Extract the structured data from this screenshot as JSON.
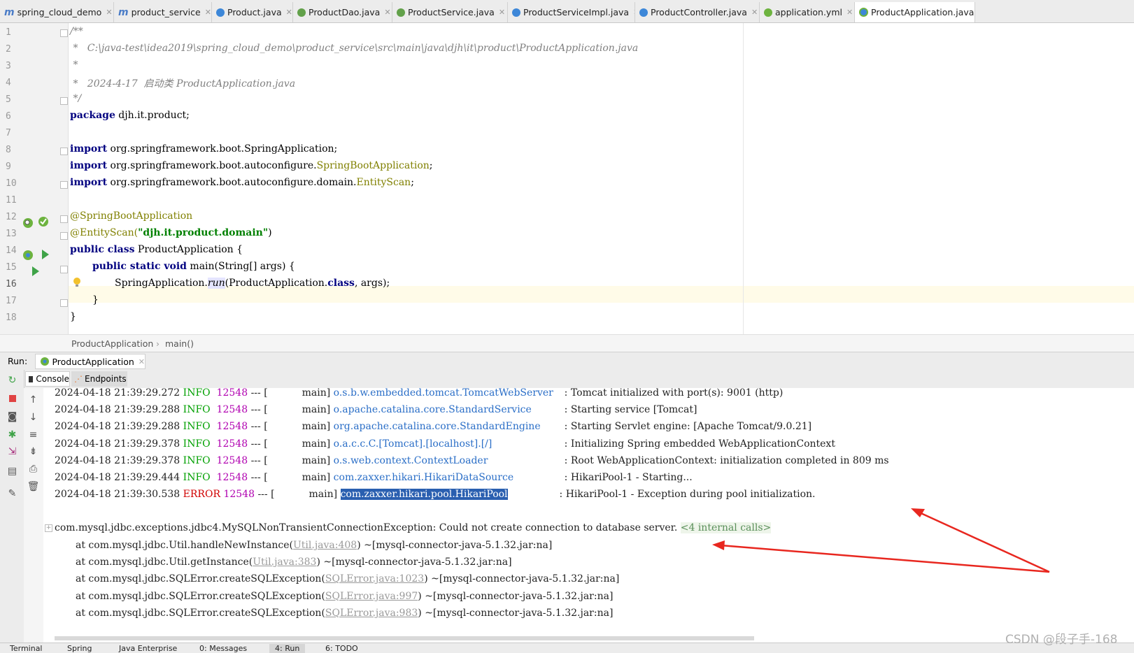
{
  "tabs": [
    {
      "label": "spring_cloud_demo",
      "icon": "maven-icon",
      "active": false
    },
    {
      "label": "product_service",
      "icon": "maven-icon",
      "active": false
    },
    {
      "label": "Product.java",
      "icon": "class-icon",
      "active": false
    },
    {
      "label": "ProductDao.java",
      "icon": "interface-icon",
      "active": false
    },
    {
      "label": "ProductService.java",
      "icon": "interface-icon",
      "active": false
    },
    {
      "label": "ProductServiceImpl.java",
      "icon": "class-icon",
      "active": false
    },
    {
      "label": "ProductController.java",
      "icon": "class-icon",
      "active": false
    },
    {
      "label": "application.yml",
      "icon": "spring-yml-icon",
      "active": false
    },
    {
      "label": "ProductApplication.java",
      "icon": "spring-class-icon",
      "active": true
    }
  ],
  "editor": {
    "line_numbers": [
      "1",
      "2",
      "3",
      "4",
      "5",
      "6",
      "7",
      "8",
      "9",
      "10",
      "11",
      "12",
      "13",
      "14",
      "15",
      "16",
      "17",
      "18"
    ],
    "comment_open": "/**",
    "comment_path": " *   C:\\java-test\\idea2019\\spring_cloud_demo\\product_service\\src\\main\\java\\djh\\it\\product\\ProductApplication.java",
    "comment_star": " *",
    "comment_date": " *   2024-4-17  启动类 ProductApplication.java",
    "comment_close": " */",
    "kw_package": "package",
    "package_name": " djh.it.product;",
    "kw_import": "import",
    "import1": " org.springframework.boot.SpringApplication;",
    "import2_pre": " org.springframework.boot.autoconfigure.",
    "import2_ann": "SpringBootApplication",
    "import3_pre": " org.springframework.boot.autoconfigure.domain.",
    "import3_ann": "EntityScan",
    "semicolon": ";",
    "ann1": "@SpringBootApplication",
    "ann2": "@EntityScan(",
    "ann2_str": "\"djh.it.product.domain\"",
    "ann2_close": ")",
    "kw_public_class": "public class",
    "class_decl": " ProductApplication {",
    "kw_main": "public static void",
    "main_decl": " main(String[] args) {",
    "run_pre": "SpringApplication.",
    "run_method": "run",
    "run_mid": "(ProductApplication.",
    "kw_class": "class",
    "run_end": ", args);",
    "brace_inner": "}",
    "brace_outer": "}"
  },
  "breadcrumb": {
    "items": [
      "ProductApplication",
      "main()"
    ],
    "sep": "›"
  },
  "run_panel": {
    "run_label": "Run:",
    "config_name": "ProductApplication",
    "console_tab": "Console",
    "endpoints_tab": "Endpoints"
  },
  "console": {
    "log_lines": [
      {
        "ts": "2024-04-18 21:39:29.272",
        "level": "INFO",
        "pid": "12548",
        "sep": "---",
        "thread": "[           main]",
        "logger": "o.s.b.w.embedded.tomcat.TomcatWebServer",
        "msg": ": Tomcat initialized with port(s): 9001 (http)"
      },
      {
        "ts": "2024-04-18 21:39:29.288",
        "level": "INFO",
        "pid": "12548",
        "sep": "---",
        "thread": "[           main]",
        "logger": "o.apache.catalina.core.StandardService",
        "msg": ": Starting service [Tomcat]"
      },
      {
        "ts": "2024-04-18 21:39:29.288",
        "level": "INFO",
        "pid": "12548",
        "sep": "---",
        "thread": "[           main]",
        "logger": "org.apache.catalina.core.StandardEngine",
        "msg": ": Starting Servlet engine: [Apache Tomcat/9.0.21]"
      },
      {
        "ts": "2024-04-18 21:39:29.378",
        "level": "INFO",
        "pid": "12548",
        "sep": "---",
        "thread": "[           main]",
        "logger": "o.a.c.c.C.[Tomcat].[localhost].[/]",
        "msg": ": Initializing Spring embedded WebApplicationContext"
      },
      {
        "ts": "2024-04-18 21:39:29.378",
        "level": "INFO",
        "pid": "12548",
        "sep": "---",
        "thread": "[           main]",
        "logger": "o.s.web.context.ContextLoader",
        "msg": ": Root WebApplicationContext: initialization completed in 809 ms"
      },
      {
        "ts": "2024-04-18 21:39:29.444",
        "level": "INFO",
        "pid": "12548",
        "sep": "---",
        "thread": "[           main]",
        "logger": "com.zaxxer.hikari.HikariDataSource",
        "msg": ": HikariPool-1 - Starting..."
      },
      {
        "ts": "2024-04-18 21:39:30.538",
        "level": "ERROR",
        "pid": "12548",
        "sep": "---",
        "thread": "[           main]",
        "logger": "com.zaxxer.hikari.pool.HikariPool",
        "msg": ": HikariPool-1 - Exception during pool initialization."
      }
    ],
    "exception": "com.mysql.jdbc.exceptions.jdbc4.MySQLNonTransientConnectionException: Could not create connection to database server.",
    "internal_calls": "<4 internal calls>",
    "stack": [
      {
        "at": "at com.mysql.jdbc.Util.handleNewInstance(",
        "loc": "Util.java:408",
        "jar": ") ~[mysql-connector-java-5.1.32.jar:na]"
      },
      {
        "at": "at com.mysql.jdbc.Util.getInstance(",
        "loc": "Util.java:383",
        "jar": ") ~[mysql-connector-java-5.1.32.jar:na]"
      },
      {
        "at": "at com.mysql.jdbc.SQLError.createSQLException(",
        "loc": "SQLError.java:1023",
        "jar": ") ~[mysql-connector-java-5.1.32.jar:na]"
      },
      {
        "at": "at com.mysql.jdbc.SQLError.createSQLException(",
        "loc": "SQLError.java:997",
        "jar": ") ~[mysql-connector-java-5.1.32.jar:na]"
      },
      {
        "at": "at com.mysql.jdbc.SQLError.createSQLException(",
        "loc": "SQLError.java:983",
        "jar": ") ~[mysql-connector-java-5.1.32.jar:na]"
      }
    ]
  },
  "bottom_tabs": [
    "Terminal",
    "Spring",
    "Java Enterprise",
    "0: Messages",
    "4: Run",
    "6: TODO"
  ],
  "watermark": "CSDN @段子手-168",
  "colors": {
    "arrow": "#e8271f",
    "selection": "#2a5fb0",
    "info": "#00a000",
    "error": "#d00000"
  }
}
